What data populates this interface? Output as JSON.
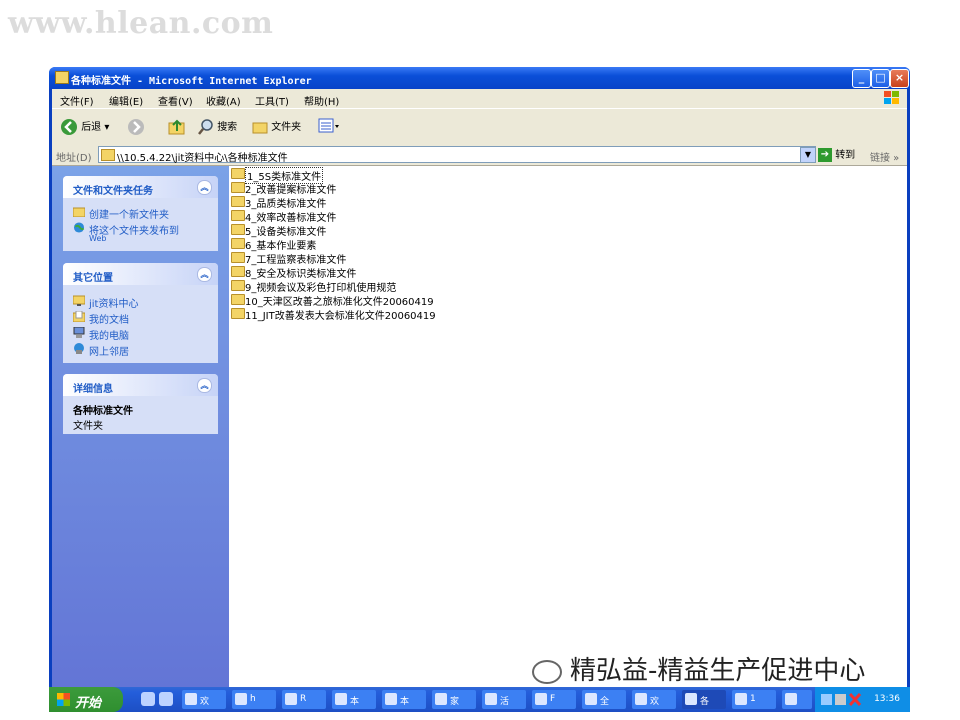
{
  "watermark": "www.hlean.com",
  "window": {
    "title": "各种标准文件 - Microsoft Internet Explorer",
    "minimize": "_",
    "maximize": "□",
    "close": "×"
  },
  "menu": [
    "文件(F)",
    "编辑(E)",
    "查看(V)",
    "收藏(A)",
    "工具(T)",
    "帮助(H)"
  ],
  "toolbar": {
    "back": "后退",
    "search": "搜索",
    "folders": "文件夹"
  },
  "address": {
    "label": "地址(D)",
    "value": "\\\\10.5.4.22\\jit资料中心\\各种标准文件",
    "go": "转到",
    "links": "链接"
  },
  "tasks_panel": {
    "title": "文件和文件夹任务",
    "items": [
      "创建一个新文件夹",
      "将这个文件夹发布到",
      "Web"
    ]
  },
  "places_panel": {
    "title": "其它位置",
    "items": [
      "jit资料中心",
      "我的文档",
      "我的电脑",
      "网上邻居"
    ]
  },
  "details_panel": {
    "title": "详细信息",
    "name": "各种标准文件",
    "type": "文件夹"
  },
  "files": [
    "1_5S类标准文件",
    "2_改善提案标准文件",
    "3_品质类标准文件",
    "4_效率改善标准文件",
    "5_设备类标准文件",
    "6_基本作业要素",
    "7_工程监察表标准文件",
    "8_安全及标识类标准文件",
    "9_视频会议及彩色打印机使用规范",
    "10_天津区改善之旅标准化文件20060419",
    "11_JIT改善发表大会标准化文件20060419"
  ],
  "taskbar": {
    "start": "开始",
    "tasks": [
      "欢",
      "h",
      "R",
      "本",
      "本",
      "家",
      "活",
      "F",
      "全",
      "欢",
      "各",
      "1",
      ""
    ],
    "clock": "13:36"
  },
  "footer_watermark": "精弘益-精益生产促进中心"
}
